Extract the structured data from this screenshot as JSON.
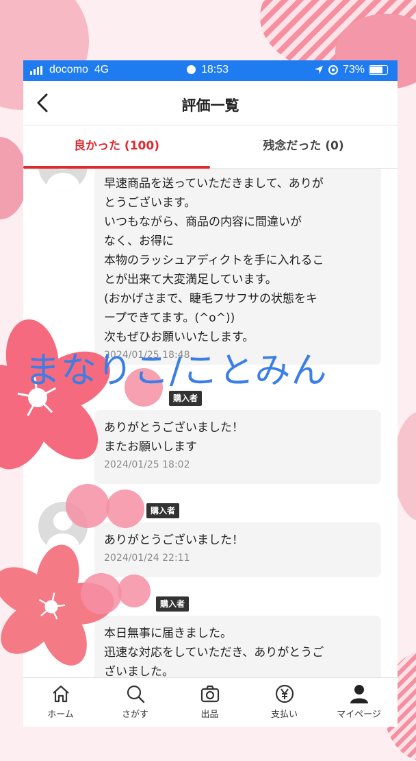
{
  "status_bar": {
    "carrier": "docomo",
    "network": "4G",
    "time": "18:53",
    "battery": "73%"
  },
  "nav": {
    "title": "評価一覧"
  },
  "tabs": [
    {
      "label": "良かった (100)",
      "active": true
    },
    {
      "label": "残念だった (0)",
      "active": false
    }
  ],
  "reviews": [
    {
      "text": "早速商品を送っていただきまして、ありが\nとうございます。\nいつもながら、商品の内容に間違いが\nなく、お得に\n本物のラッシュアディクトを手に入れるこ\nとが出来て大変満足しています。\n(おかげさまで、睫毛フサフサの状態をキ\nープできてます。(^o^))\n次もぜひお願いいたします。",
      "date": "2024/01/25 18:48"
    },
    {
      "badge": "購入者",
      "text": "ありがとうございました！\nまたお願いします",
      "date": "2024/01/25 18:02"
    },
    {
      "badge": "購入者",
      "text": "ありがとうございました！",
      "date": "2024/01/24 22:11"
    },
    {
      "badge": "購入者",
      "text": "本日無事に届きました。\n迅速な対応をしていただき、ありがとうご\nざいました。"
    }
  ],
  "tab_bar": [
    {
      "label": "ホーム",
      "icon": "home-icon"
    },
    {
      "label": "さがす",
      "icon": "search-icon"
    },
    {
      "label": "出品",
      "icon": "camera-icon"
    },
    {
      "label": "支払い",
      "icon": "yen-icon"
    },
    {
      "label": "マイページ",
      "icon": "person-icon"
    }
  ],
  "watermark": "まなりこ/ことみん",
  "colors": {
    "status_bar": "#1f7cf0",
    "accent": "#e0282d",
    "watermark": "#3a7ee6",
    "sakura": "#f56a7e"
  }
}
